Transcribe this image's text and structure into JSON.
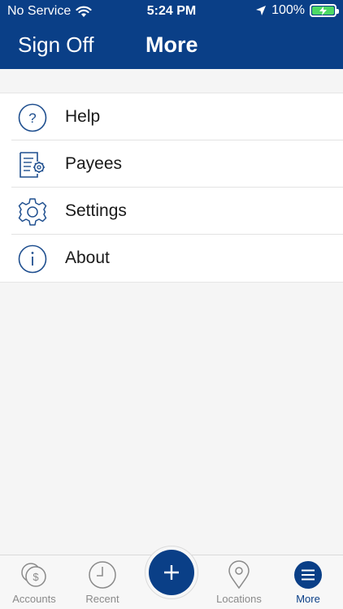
{
  "status_bar": {
    "carrier": "No Service",
    "time": "5:24 PM",
    "battery": "100%",
    "battery_level_percent": 100,
    "battery_color": "#4cd964"
  },
  "header": {
    "left_button": "Sign Off",
    "title": "More",
    "background_color": "#0a3f87"
  },
  "menu": {
    "items": [
      {
        "label": "Help",
        "icon": "help-circle-icon"
      },
      {
        "label": "Payees",
        "icon": "payees-document-gear-icon"
      },
      {
        "label": "Settings",
        "icon": "gear-icon"
      },
      {
        "label": "About",
        "icon": "info-circle-icon"
      }
    ]
  },
  "tabbar": {
    "tabs": [
      {
        "label": "Accounts",
        "icon": "accounts-coins-icon",
        "active": false
      },
      {
        "label": "Recent",
        "icon": "clock-icon",
        "active": false
      },
      {
        "label": "",
        "icon": "plus-icon",
        "active": false
      },
      {
        "label": "Locations",
        "icon": "location-pin-icon",
        "active": false
      },
      {
        "label": "More",
        "icon": "menu-lines-icon",
        "active": true
      }
    ],
    "active_color": "#0a3f87",
    "inactive_color": "#8a8a8a"
  }
}
